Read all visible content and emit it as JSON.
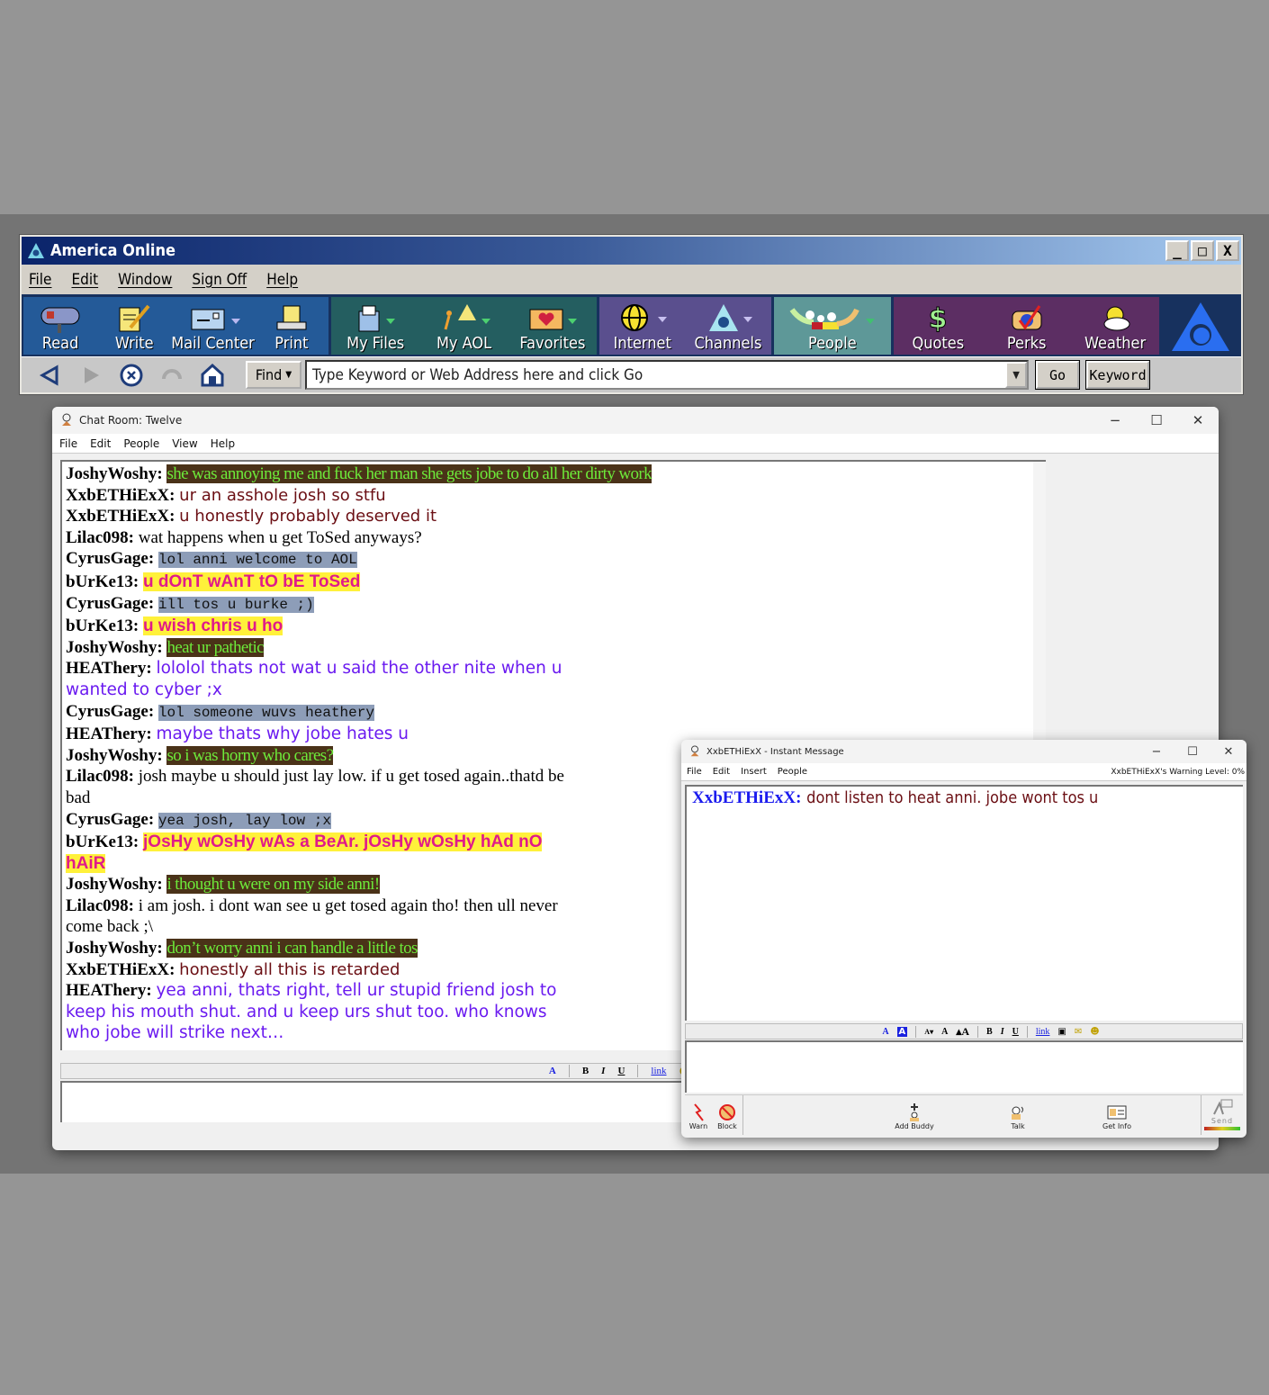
{
  "aol_window": {
    "title": "America  Online",
    "controls": [
      "_",
      "□",
      "X"
    ],
    "menu": [
      "File",
      "Edit",
      "Window",
      "Sign Off",
      "Help"
    ],
    "toolbar": {
      "groups": [
        {
          "color": "#245a98",
          "buttons": [
            {
              "label": "Read",
              "icon": "mailbox-icon"
            },
            {
              "label": "Write",
              "icon": "write-pencil-icon"
            },
            {
              "label": "Mail Center",
              "icon": "mail-center-icon",
              "dropdown": true
            },
            {
              "label": "Print",
              "icon": "printer-icon"
            }
          ]
        },
        {
          "color": "#245e60",
          "buttons": [
            {
              "label": "My Files",
              "icon": "file-cabinet-icon",
              "dropdown": true
            },
            {
              "label": "My AOL",
              "icon": "my-aol-icon",
              "dropdown": true
            },
            {
              "label": "Favorites",
              "icon": "heart-folder-icon",
              "dropdown": true
            }
          ]
        },
        {
          "color": "#5a4f8e",
          "buttons": [
            {
              "label": "Internet",
              "icon": "globe-icon",
              "dropdown": true
            },
            {
              "label": "Channels",
              "icon": "channels-icon",
              "dropdown": true
            }
          ]
        },
        {
          "color": "#5e9898",
          "buttons": [
            {
              "label": "People",
              "icon": "people-icon",
              "dropdown": true
            }
          ]
        },
        {
          "color": "#5c2e63",
          "buttons": [
            {
              "label": "Quotes",
              "icon": "dollar-icon"
            },
            {
              "label": "Perks",
              "icon": "telephone-check-icon"
            },
            {
              "label": "Weather",
              "icon": "sun-cloud-icon"
            }
          ]
        }
      ]
    },
    "navbar": {
      "find_label": "Find",
      "address_placeholder": "Type Keyword or Web Address here and click Go",
      "go_label": "Go",
      "keyword_label": "Keyword"
    }
  },
  "chat_window": {
    "title": "Chat Room: Twelve",
    "menu": [
      "File",
      "Edit",
      "People",
      "View",
      "Help"
    ],
    "format_bar": [
      "A",
      "B",
      "I",
      "U",
      "link",
      "smiley"
    ],
    "messages": [
      {
        "who": "JoshyWoshy:",
        "style": "josh",
        "text": "she was annoying me and fuck her man she gets jobe to do all her dirty work"
      },
      {
        "who": "XxbETHiExX:",
        "style": "beth",
        "text": "ur an asshole josh so stfu"
      },
      {
        "who": "XxbETHiExX:",
        "style": "beth",
        "text": "u honestly probably deserved it"
      },
      {
        "who": "Lilac098:",
        "style": "lilac",
        "text": "wat happens when u get ToSed anyways?"
      },
      {
        "who": "CyrusGage:",
        "style": "cyrus",
        "text": "lol anni welcome to AOL"
      },
      {
        "who": "bUrKe13:",
        "style": "burke",
        "text": "u dOnT wAnT tO bE ToSed "
      },
      {
        "who": "CyrusGage:",
        "style": "cyrus",
        "text": "ill tos u burke ;)"
      },
      {
        "who": "bUrKe13:",
        "style": "burke",
        "text": "u wish chris u ho "
      },
      {
        "who": "JoshyWoshy:",
        "style": "josh",
        "text": "heat ur pathetic"
      },
      {
        "who": "HEAThery:",
        "style": "heat",
        "text": "lololol thats not wat u said the other nite when u wanted to cyber ;x"
      },
      {
        "who": "CyrusGage:",
        "style": "cyrus",
        "text": "lol someone wuvs heathery"
      },
      {
        "who": "HEAThery:",
        "style": "heat",
        "text": "maybe thats why jobe hates u"
      },
      {
        "who": "JoshyWoshy:",
        "style": "josh",
        "text": "so i was horny who cares?"
      },
      {
        "who": "Lilac098:",
        "style": "lilac",
        "text": "josh maybe u should just lay low. if u get tosed again..thatd be bad"
      },
      {
        "who": "CyrusGage:",
        "style": "cyrus",
        "text": "yea josh, lay low ;x"
      },
      {
        "who": "bUrKe13:",
        "style": "burke",
        "text": "jOsHy wOsHy wAs a BeAr.  jOsHy wOsHy hAd nO hAiR"
      },
      {
        "who": "JoshyWoshy:",
        "style": "josh",
        "text": "i thought u were on my side anni!"
      },
      {
        "who": "Lilac098:",
        "style": "lilac",
        "text": "i am josh. i dont wan see u get tosed again tho! then ull never come back ;\\"
      },
      {
        "who": "JoshyWoshy:",
        "style": "josh",
        "text": "don’t worry anni i can handle a little tos"
      },
      {
        "who": "XxbETHiExX:",
        "style": "beth",
        "text": "honestly all this is retarded"
      },
      {
        "who": "HEAThery:",
        "style": "heat",
        "text": "yea anni, thats right, tell ur stupid friend josh to keep his mouth shut. and u keep urs shut too. who knows who jobe will strike next…"
      }
    ],
    "input_value": ""
  },
  "im_window": {
    "title": "XxbETHiExX - Instant Message",
    "menu": [
      "File",
      "Edit",
      "Insert",
      "People"
    ],
    "warning_level": "XxbETHiExX's Warning Level: 0%",
    "messages": [
      {
        "who": "XxbETHiExX:",
        "text": "dont listen to heat anni. jobe wont tos u"
      }
    ],
    "format_bar": [
      "text-color",
      "background-color",
      "smaller-font",
      "normal-font",
      "larger-font",
      "B",
      "I",
      "U",
      "link",
      "picture",
      "envelope",
      "smiley"
    ],
    "input_value": "",
    "actions": {
      "warn": "Warn",
      "block": "Block",
      "add_buddy": "Add Buddy",
      "talk": "Talk",
      "get_info": "Get Info",
      "send": "Send"
    }
  },
  "colors": {
    "josh_bg": "#4a3218",
    "josh_fg": "#6dea3a",
    "beth_fg": "#6b0f14",
    "cyrus_bg": "#8d9db8",
    "burke_bg": "#fff13a",
    "burke_fg": "#e01a8a",
    "heat_fg": "#6a1af0"
  }
}
